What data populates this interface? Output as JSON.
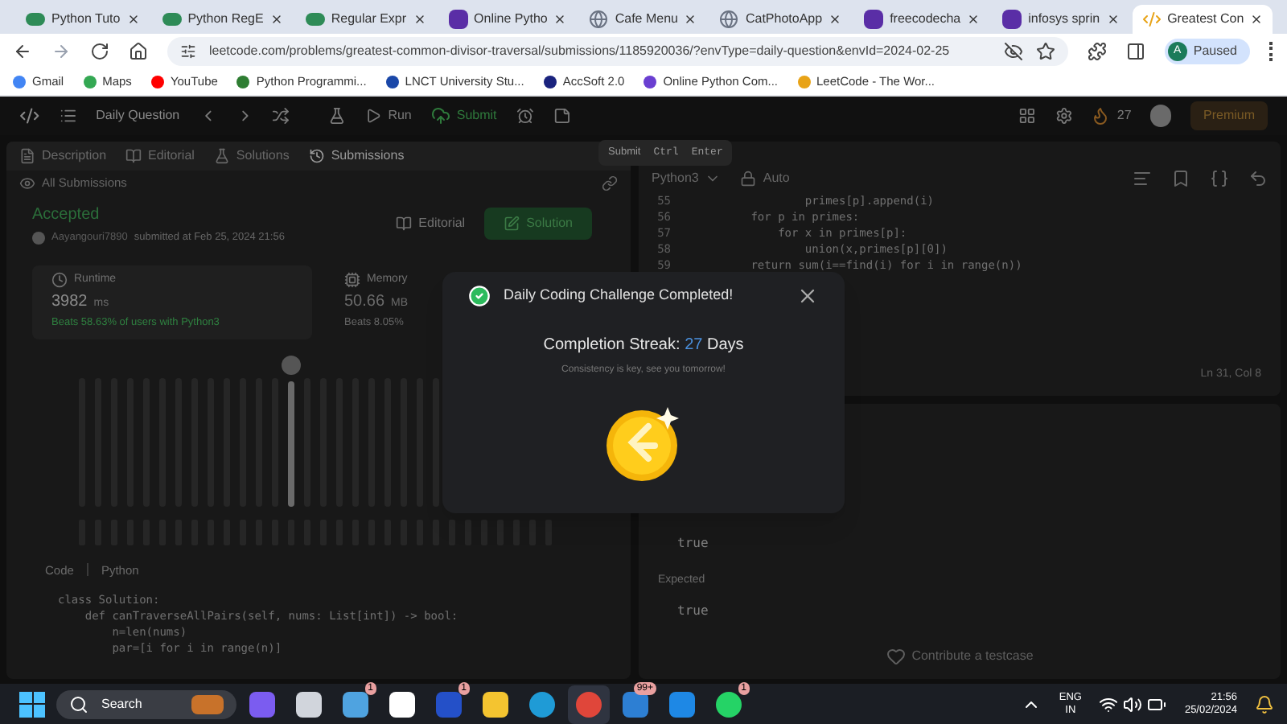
{
  "browser": {
    "tabs": [
      {
        "title": "Python Tuto",
        "kind": "w3",
        "selected": false
      },
      {
        "title": "Python RegE",
        "kind": "w3",
        "selected": false
      },
      {
        "title": "Regular Expr",
        "kind": "w3",
        "selected": false
      },
      {
        "title": "Online Pytho",
        "kind": "purple",
        "selected": false
      },
      {
        "title": "Cafe Menu",
        "kind": "globe",
        "selected": false
      },
      {
        "title": "CatPhotoApp",
        "kind": "globe",
        "selected": false
      },
      {
        "title": "freecodecha",
        "kind": "purple",
        "selected": false
      },
      {
        "title": "infosys sprin",
        "kind": "purple",
        "selected": false
      },
      {
        "title": "Greatest Con",
        "kind": "leetcode",
        "selected": true
      }
    ],
    "url": "leetcode.com/problems/greatest-common-divisor-traversal/submissions/1185920036/?envType=daily-question&envId=2024-02-25",
    "profile_initial": "A",
    "profile": "Paused",
    "bookmarks": [
      {
        "label": "Gmail",
        "color": "#4285f4"
      },
      {
        "label": "Maps",
        "color": "#34a853"
      },
      {
        "label": "YouTube",
        "color": "#ff0000"
      },
      {
        "label": "Python Programmi...",
        "color": "#2e7d32"
      },
      {
        "label": "LNCT University Stu...",
        "color": "#1a47a8"
      },
      {
        "label": "AccSoft 2.0",
        "color": "#1a237e"
      },
      {
        "label": "Online Python Com...",
        "color": "#6a3fd1"
      },
      {
        "label": "LeetCode - The Wor...",
        "color": "#e8a317"
      }
    ]
  },
  "nav": {
    "title": "Daily Question",
    "run": "Run",
    "submit": "Submit",
    "streak": "27",
    "premium": "Premium"
  },
  "tooltip": {
    "label": "Submit",
    "keys": [
      "Ctrl",
      "Enter"
    ]
  },
  "left": {
    "tabs": [
      {
        "label": "Description",
        "selected": false
      },
      {
        "label": "Editorial",
        "selected": false
      },
      {
        "label": "Solutions",
        "selected": false
      },
      {
        "label": "Submissions",
        "selected": true
      }
    ],
    "back": "All Submissions",
    "status": "Accepted",
    "user": "Aayangouri7890",
    "submitted": "submitted at Feb 25, 2024 21:56",
    "editorial": "Editorial",
    "solution": "Solution",
    "stats": [
      {
        "label": "Runtime",
        "value": "3982",
        "unit": "ms",
        "beats": "Beats 58.63% of users with Python3",
        "selected": true
      },
      {
        "label": "Memory",
        "value": "50.66",
        "unit": "MB",
        "beats": "Beats 8.05%",
        "selected": false
      }
    ],
    "code_label": "Code",
    "language": "Python",
    "code": [
      "class Solution:",
      "    def canTraverseAllPairs(self, nums: List[int]) -> bool:",
      "        n=len(nums)",
      "        par=[i for i in range(n)]"
    ]
  },
  "editor": {
    "language": "Python3",
    "mode": "Auto",
    "lines": [
      {
        "number": "55",
        "text": "                primes[p].append(i)"
      },
      {
        "number": "56",
        "text": "        for p in primes:"
      },
      {
        "number": "57",
        "text": "            for x in primes[p]:"
      },
      {
        "number": "58",
        "text": "                union(x,primes[p][0])"
      },
      {
        "number": "59",
        "text": "        return sum(i==find(i) for i in range(n))"
      }
    ],
    "position": "Ln 31, Col 8"
  },
  "results": {
    "output": "true",
    "expected_label": "Expected",
    "expected": "true",
    "contribute": "Contribute a testcase"
  },
  "modal": {
    "title": "Daily Coding Challenge Completed!",
    "streak_label": "Completion Streak:",
    "streak": "27",
    "streak_unit": "Days",
    "message": "Consistency is key, see you tomorrow!"
  },
  "taskbar": {
    "search": "Search",
    "apps": [
      {
        "kind": "copilot"
      },
      {
        "kind": "taskview"
      },
      {
        "kind": "weather",
        "badge": "1"
      },
      {
        "kind": "store"
      },
      {
        "kind": "letter",
        "badge": "1"
      },
      {
        "kind": "files"
      },
      {
        "kind": "edge"
      },
      {
        "kind": "chrome",
        "selected": true
      },
      {
        "kind": "mail",
        "badge": "99+"
      },
      {
        "kind": "vscode"
      },
      {
        "kind": "whatsapp",
        "badge": "1"
      }
    ],
    "lang": [
      "ENG",
      "IN"
    ],
    "time": "21:56",
    "date": "25/02/2024"
  }
}
